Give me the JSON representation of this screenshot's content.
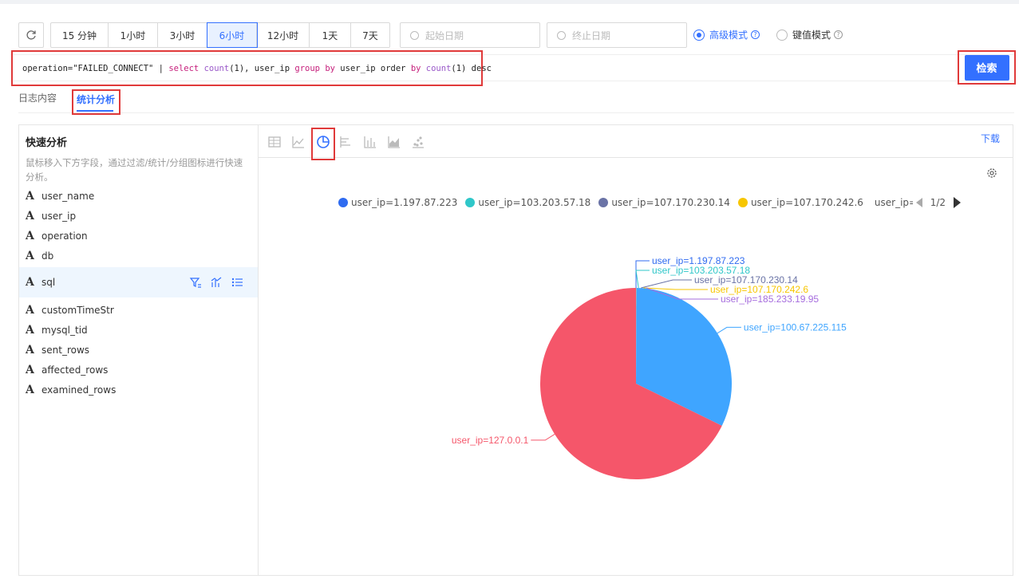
{
  "toolbar": {
    "time_ranges": [
      {
        "label": "15 分钟",
        "active": false
      },
      {
        "label": "1小时",
        "active": false
      },
      {
        "label": "3小时",
        "active": false
      },
      {
        "label": "6小时",
        "active": true
      },
      {
        "label": "12小时",
        "active": false
      },
      {
        "label": "1天",
        "active": false
      },
      {
        "label": "7天",
        "active": false
      }
    ],
    "start_date_placeholder": "起始日期",
    "end_date_placeholder": "终止日期",
    "mode_advanced": "高级模式",
    "mode_kv": "键值模式",
    "selected_mode": "advanced"
  },
  "query": {
    "text_parts": [
      {
        "t": "operation=\"FAILED_CONNECT\" | ",
        "c": "plain"
      },
      {
        "t": "select ",
        "c": "kw"
      },
      {
        "t": "count",
        "c": "fn"
      },
      {
        "t": "(1), user_ip ",
        "c": "plain"
      },
      {
        "t": "group by ",
        "c": "kw"
      },
      {
        "t": "user_ip order ",
        "c": "plain"
      },
      {
        "t": "by ",
        "c": "kw"
      },
      {
        "t": "count",
        "c": "fn"
      },
      {
        "t": "(1) desc",
        "c": "plain"
      }
    ],
    "search_label": "检索"
  },
  "tabs": {
    "log_content": "日志内容",
    "stats": "统计分析"
  },
  "quick_analysis": {
    "title": "快速分析",
    "description": "鼠标移入下方字段，通过过滤/统计/分组图标进行快速分析。",
    "fields": [
      "user_name",
      "user_ip",
      "operation",
      "db",
      "sql",
      "customTimeStr",
      "mysql_tid",
      "sent_rows",
      "affected_rows",
      "examined_rows"
    ],
    "highlighted_field": "sql"
  },
  "chart_panel": {
    "download_label": "下载",
    "active_chart_icon": "pie-chart-icon",
    "chart_icons": [
      "table-icon",
      "line-chart-icon",
      "pie-chart-icon",
      "horizontal-bar-icon",
      "bar-chart-icon",
      "area-chart-icon",
      "scatter-icon"
    ]
  },
  "legend": {
    "items": [
      {
        "label": "user_ip=1.197.87.223",
        "color": "#2f6bf0"
      },
      {
        "label": "user_ip=103.203.57.18",
        "color": "#2fc7c9"
      },
      {
        "label": "user_ip=107.170.230.14",
        "color": "#6a73a6"
      },
      {
        "label": "user_ip=107.170.242.6",
        "color": "#f7c600"
      },
      {
        "label": "user_ip=185.233.19.95",
        "color": "#a66dde"
      }
    ],
    "page": "1/2"
  },
  "chart_data": {
    "type": "pie",
    "title": "",
    "slices": [
      {
        "label": "user_ip=1.197.87.223",
        "value": 1,
        "color": "#2f6bf0"
      },
      {
        "label": "user_ip=103.203.57.18",
        "value": 1,
        "color": "#2fc7c9"
      },
      {
        "label": "user_ip=107.170.230.14",
        "value": 1,
        "color": "#6a73a6"
      },
      {
        "label": "user_ip=107.170.242.6",
        "value": 1,
        "color": "#f7c600"
      },
      {
        "label": "user_ip=185.233.19.95",
        "value": 1,
        "color": "#a66dde"
      },
      {
        "label": "user_ip=100.67.225.115",
        "value": 1900,
        "color": "#3fa5ff"
      },
      {
        "label": "user_ip=127.0.0.1",
        "value": 4000,
        "color": "#f5566a"
      }
    ]
  }
}
